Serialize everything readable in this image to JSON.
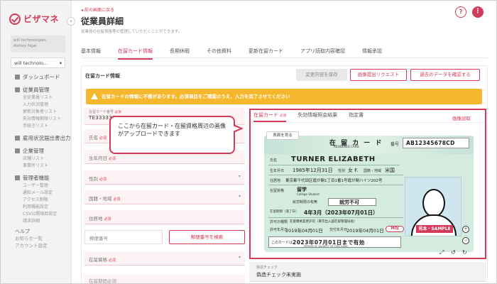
{
  "app": {
    "logo_text": "ビザマネ",
    "company_box": "will technologies\nAshley Ngai",
    "company_select": "will technolo...",
    "collapse_glyph": "‹"
  },
  "sidebar": {
    "dashboard": "ダッシュボード",
    "employee_mgmt": "従業員管理",
    "employee_subs": [
      "全従業員リスト",
      "入力状況管理",
      "更新対象者リスト",
      "失効情報期限リスト",
      "手続きリスト"
    ],
    "check_report": "雇用状況届出書出力",
    "company_info": "企業管理",
    "company_subs": [
      "店舗リスト",
      "事業所リスト"
    ],
    "admin_func": "管理者機能",
    "admin_subs": [
      "ユーザー管理",
      "通知メール設定",
      "アクセス制限",
      "利用機能設定",
      "CSV公開項目設定",
      "請求詳細"
    ],
    "help": "ヘルプ",
    "help_items": [
      "お知らせ一覧",
      "アカウント設定"
    ]
  },
  "header": {
    "back_link": "前の画面に戻る",
    "title": "従業員詳細",
    "subtitle": "従業員の在留資格等の管理していただくことができます。",
    "help_glyph": "?",
    "menu_glyph": "⋮"
  },
  "tabs": [
    "基本情報",
    "在留カード情報",
    "長期休暇",
    "その他資料",
    "更新在留カード",
    "アプリ読取内容確認",
    "情報承認"
  ],
  "card": {
    "title": "在留カード情報",
    "save_btn": "変更内容を保存",
    "request_btn": "画像提出リクエスト",
    "past_btn": "過去のデータを確認する",
    "warning": "在留カードの情報に不備があります。必須項目をご確認のうえ、入力を完了させてください"
  },
  "form": {
    "required_mark": "必須",
    "card_no_label": "在留カード番号",
    "card_no_value": "TE3333333",
    "fields": [
      {
        "label": "氏名",
        "required": true,
        "select": false
      },
      {
        "label": "生年月日",
        "required": true,
        "select": false
      },
      {
        "label": "性別",
        "required": true,
        "select": true
      },
      {
        "label": "国籍・地域",
        "required": true,
        "select": true
      },
      {
        "label": "住居地",
        "required": true,
        "select": false
      }
    ],
    "zip_placeholder": "郵便番号",
    "zip_btn": "郵便番号を検索",
    "status_label": "在留資格",
    "period_label": "在留期間",
    "caret": "▾"
  },
  "callout": {
    "text": "ここから在留カード・在留資格周辺の画像がアップロードできます"
  },
  "panel": {
    "tabs": [
      "在留カード",
      "失効情報照会結果",
      "指定書"
    ],
    "read_btn": "画像読取",
    "front_btn": "表面を見る",
    "zoom_in": "+",
    "zoom_out": "−",
    "expand_glyph": "⤢",
    "rotate_left": "↺",
    "rotate_right": "↻"
  },
  "residence_card": {
    "title": "在 留 カ ー ド",
    "title_en": "RESIDENCE CARD",
    "no_label": "番号",
    "number": "AB12345678CD",
    "name_label": "氏名",
    "name": "TURNER ELIZABETH",
    "birth_label": "生年月日",
    "birth": "1985年12月31日",
    "sex_label": "性別",
    "sex": "女 F.",
    "nat_label": "国籍・地域",
    "nationality": "米国",
    "address_label": "住居地",
    "address": "東京都千代田区霞が関1丁目1番1号霞が関ハイツ202号",
    "status_label": "在留資格",
    "status": "留学",
    "status_en": "College Student",
    "work_label": "就労制限の有無",
    "work": "就労不可",
    "period_label": "在留期間（満了日）",
    "period": "4年3月（2023年07月01日）",
    "permit_label": "許可の種類",
    "permit": "在留資格変更許可（東京出入国在留管理局長）",
    "permit_date_label": "許可年月日",
    "permit_date": "2019年04月01日",
    "issue_label": "交付年月日",
    "issue_date": "2019年04月01日",
    "sample": "見本・SAMPLE",
    "moj": "MOJ",
    "valid_label": "このカードは",
    "valid": "2023年07月01日まで有効",
    "valid_en": "PERIOD OF VALIDITY OF THIS CARD"
  },
  "fake_check": {
    "label": "偽造チェック",
    "value": "偽造チェック未実施"
  }
}
